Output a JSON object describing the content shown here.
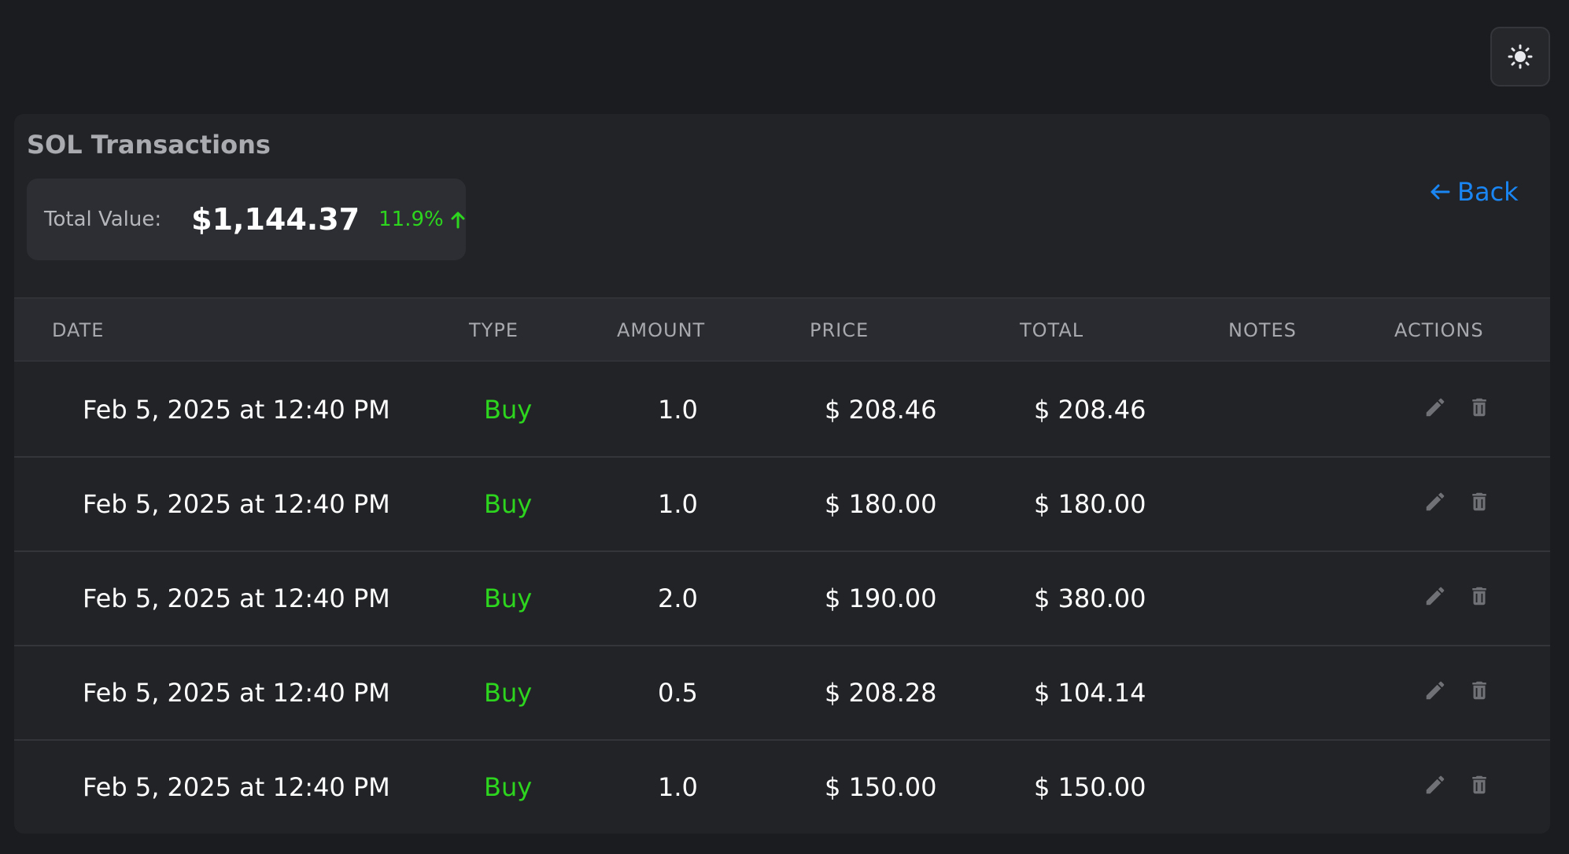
{
  "header": {
    "theme_toggle_icon": "sun-icon"
  },
  "card": {
    "title": "SOL Transactions",
    "total_value_label": "Total Value:",
    "total_value": "$1,144.37",
    "change_percent": "11.9%",
    "change_icon": "arrow-up-icon",
    "back_label": "Back",
    "back_icon": "arrow-left-icon"
  },
  "table": {
    "columns": [
      "DATE",
      "TYPE",
      "AMOUNT",
      "PRICE",
      "TOTAL",
      "NOTES",
      "ACTIONS"
    ],
    "rows": [
      {
        "date": "Feb 5, 2025 at 12:40 PM",
        "type": "Buy",
        "amount": "1.0",
        "price": "$ 208.46",
        "total": "$ 208.46",
        "notes": ""
      },
      {
        "date": "Feb 5, 2025 at 12:40 PM",
        "type": "Buy",
        "amount": "1.0",
        "price": "$ 180.00",
        "total": "$ 180.00",
        "notes": ""
      },
      {
        "date": "Feb 5, 2025 at 12:40 PM",
        "type": "Buy",
        "amount": "2.0",
        "price": "$ 190.00",
        "total": "$ 380.00",
        "notes": ""
      },
      {
        "date": "Feb 5, 2025 at 12:40 PM",
        "type": "Buy",
        "amount": "0.5",
        "price": "$ 208.28",
        "total": "$ 104.14",
        "notes": ""
      },
      {
        "date": "Feb 5, 2025 at 12:40 PM",
        "type": "Buy",
        "amount": "1.0",
        "price": "$ 150.00",
        "total": "$ 150.00",
        "notes": ""
      }
    ],
    "row_actions": [
      "edit-icon",
      "trash-icon"
    ]
  },
  "colors": {
    "background": "#1b1c1f",
    "card": "#222327",
    "positive": "#2dd51e",
    "link": "#1a86f3"
  }
}
